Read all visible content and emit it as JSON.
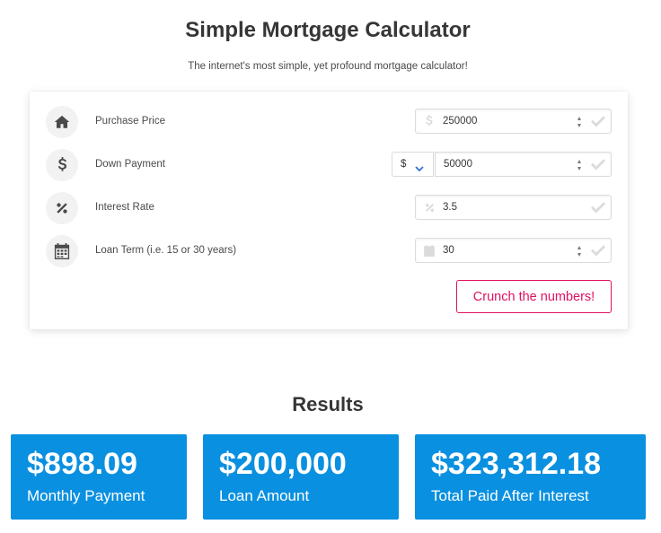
{
  "header": {
    "title": "Simple Mortgage Calculator",
    "subtitle": "The internet's most simple, yet profound mortgage calculator!"
  },
  "form": {
    "rows": [
      {
        "label": "Purchase Price",
        "icon": "home-icon",
        "value": "250000",
        "input_icon": "dollar-icon"
      },
      {
        "label": "Down Payment",
        "icon": "dollar-icon",
        "value": "50000",
        "select_value": "$"
      },
      {
        "label": "Interest Rate",
        "icon": "percent-icon",
        "value": "3.5",
        "input_icon": "percent-icon"
      },
      {
        "label": "Loan Term (i.e. 15 or 30 years)",
        "icon": "calendar-icon",
        "value": "30",
        "input_icon": "calendar-icon"
      }
    ],
    "submit_label": "Crunch the numbers!"
  },
  "results": {
    "title": "Results",
    "cards": [
      {
        "value": "$898.09",
        "label": "Monthly Payment"
      },
      {
        "value": "$200,000",
        "label": "Loan Amount"
      },
      {
        "value": "$323,312.18",
        "label": "Total Paid After Interest"
      }
    ]
  },
  "colors": {
    "accent": "#e0115f",
    "result_bg": "#0a90e0",
    "text": "#363636",
    "check": "#dbdbdb"
  }
}
